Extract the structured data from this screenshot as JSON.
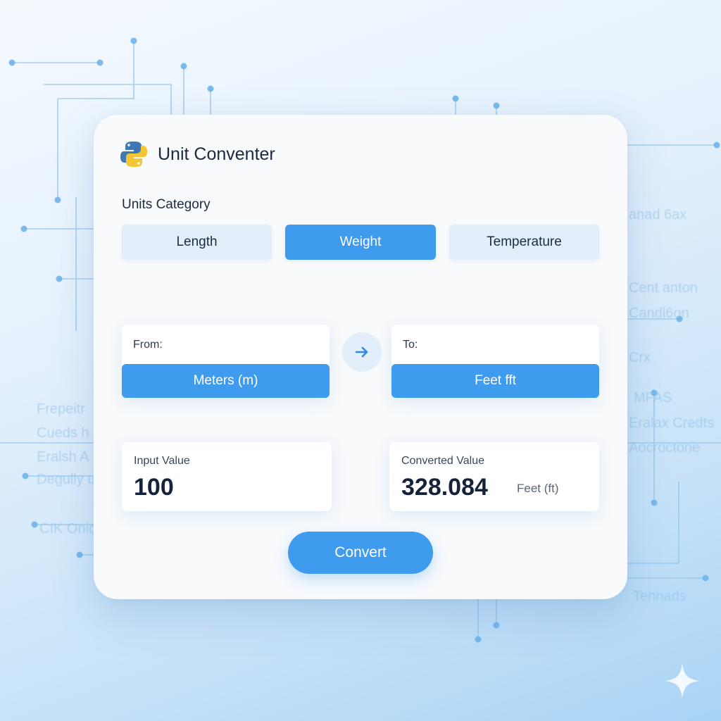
{
  "app": {
    "title": "Unit Conventer"
  },
  "category": {
    "label": "Units Category",
    "options": [
      "Length",
      "Weight",
      "Temperature"
    ],
    "selected": "Weight"
  },
  "from": {
    "label": "From:",
    "unit": "Meters (m)"
  },
  "to": {
    "label": "To:",
    "unit": "Feet fft"
  },
  "input": {
    "caption": "Input Value",
    "value": "100"
  },
  "output": {
    "caption": "Converted Value",
    "value": "328.084",
    "unit": "Feet (ft)"
  },
  "actions": {
    "convert_label": "Convert"
  },
  "background_text": {
    "left": [
      "Frepeitr",
      "Cueds h",
      "Eralsh A",
      "Degully u",
      "CIK Oniol"
    ],
    "right": [
      "anad 6ax",
      "Cent anton",
      "Candl6on",
      "Crx",
      "MFAS",
      "Eralax Credts",
      "Aocroctone",
      "Tennads"
    ]
  },
  "colors": {
    "accent": "#3f9bee",
    "accent_soft": "#e2eefa",
    "card": "#f8fafc",
    "text_dark": "#1b2a3d",
    "circuit": "#6fb4ea"
  },
  "icons": {
    "logo": "python-logo-icon",
    "swap": "arrow-right-icon",
    "decor": "sparkle-icon"
  }
}
